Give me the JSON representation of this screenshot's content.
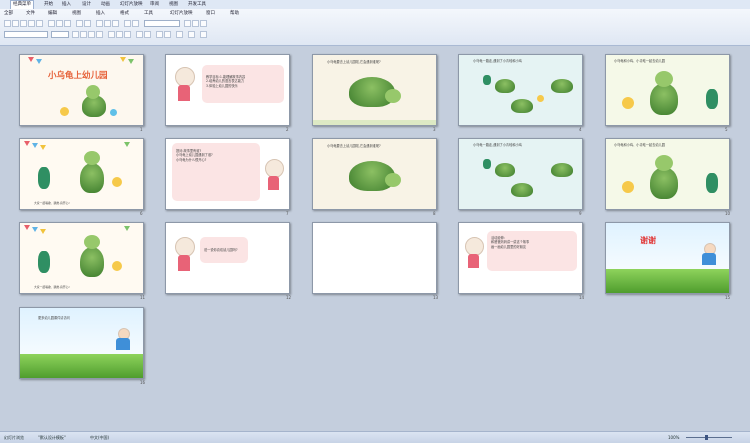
{
  "ribbon": {
    "tabs": [
      "经典菜单",
      "开始",
      "插入",
      "设计",
      "动画",
      "幻灯片放映",
      "审阅",
      "视图",
      "开发工具"
    ],
    "menus": [
      "全部",
      "文件",
      "编辑",
      "视图",
      "插入",
      "格式",
      "工具",
      "幻灯片放映",
      "窗口",
      "帮助"
    ]
  },
  "slides": [
    {
      "num": "1",
      "title": "小乌龟上幼儿园"
    },
    {
      "num": "2",
      "lines": [
        "教学目标:1.能理解故事内容",
        "2.培养幼儿的语言表达能力",
        "3.体验上幼儿园的快乐"
      ]
    },
    {
      "num": "3",
      "lines": [
        "小乌龟要去上幼儿园啦,它会遇到谁呢?"
      ]
    },
    {
      "num": "4",
      "lines": [
        "小乌龟一路走,遇到了小青蛙和小鸡"
      ]
    },
    {
      "num": "5",
      "lines": [
        "小乌龟和小鸡、小青蛙一起去幼儿园"
      ]
    },
    {
      "num": "6",
      "lines": [
        "大家一起唱歌、跳舞,真开心!"
      ]
    },
    {
      "num": "7",
      "lines": [
        "提问:故事里有谁?",
        "小乌龟上幼儿园遇到了谁?",
        "小乌龟为什么很开心?"
      ]
    },
    {
      "num": "8",
      "lines": [
        "小乌龟要去上幼儿园啦,它会遇到谁呢?"
      ]
    },
    {
      "num": "9",
      "lines": [
        "小乌龟一路走,遇到了小青蛙和小鸡"
      ]
    },
    {
      "num": "10",
      "lines": [
        "小乌龟和小鸡、小青蛙一起去幼儿园"
      ]
    },
    {
      "num": "11",
      "lines": [
        "大家一起唱歌、跳舞,真开心!"
      ]
    },
    {
      "num": "12",
      "lines": [
        "说一说你喜欢幼儿园吗?"
      ]
    },
    {
      "num": "13",
      "lines": []
    },
    {
      "num": "14",
      "lines": [
        "活动延伸:",
        "和爸爸妈妈讲一讲这个故事",
        "画一画幼儿园里的好朋友"
      ]
    },
    {
      "num": "15",
      "title": "谢谢"
    },
    {
      "num": "16",
      "lines": [
        "更多幼儿园课件请访问"
      ]
    }
  ],
  "status": {
    "view": "幻灯片浏览",
    "theme": "\"默认设计模板\"",
    "lang": "中文(中国)",
    "zoom": "100%"
  }
}
